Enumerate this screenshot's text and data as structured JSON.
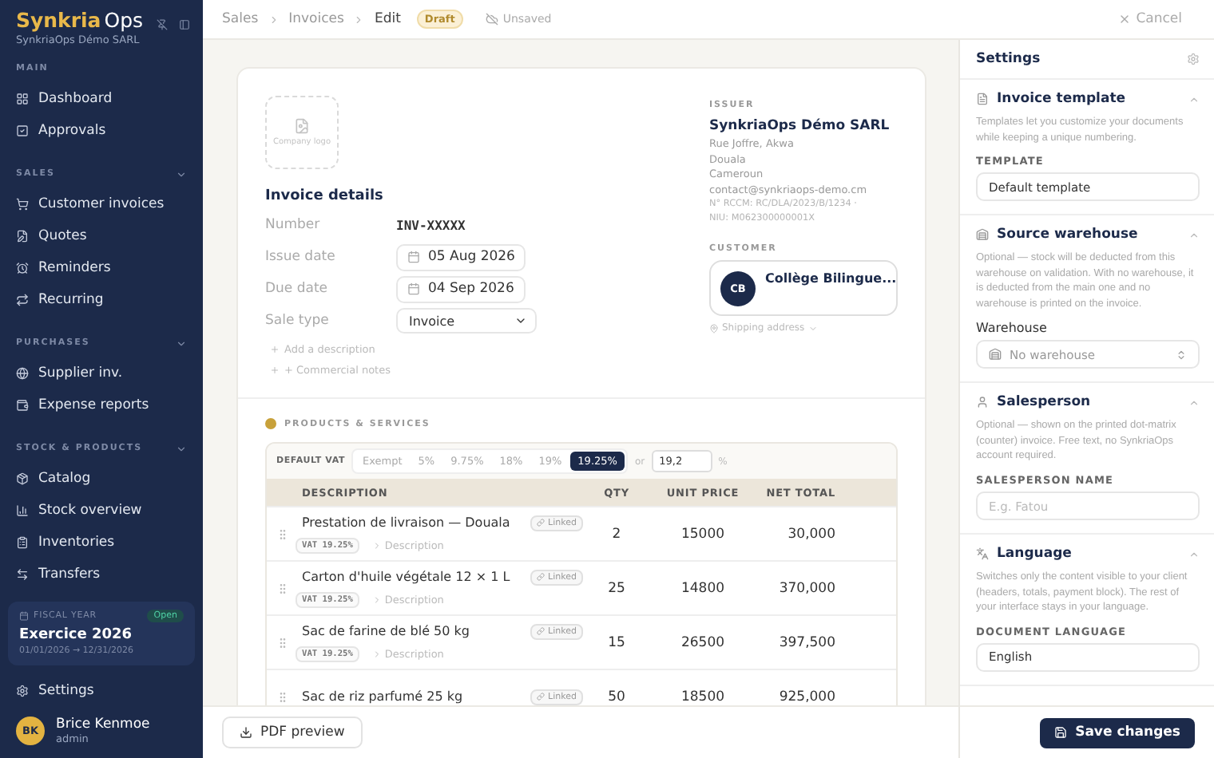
{
  "sidebar": {
    "brand": {
      "primary": "Synkria",
      "secondary": "Ops"
    },
    "company": "SynkriaOps Démo SARL",
    "sections": [
      {
        "label": "MAIN",
        "items": [
          {
            "label": "Dashboard"
          },
          {
            "label": "Approvals"
          }
        ]
      },
      {
        "label": "SALES",
        "expanded": true,
        "items": [
          {
            "label": "Customer invoices"
          },
          {
            "label": "Quotes"
          },
          {
            "label": "Reminders"
          },
          {
            "label": "Recurring"
          }
        ]
      },
      {
        "label": "PURCHASES",
        "expanded": true,
        "items": [
          {
            "label": "Supplier inv."
          },
          {
            "label": "Expense reports"
          }
        ]
      },
      {
        "label": "STOCK & PRODUCTS",
        "expanded": true,
        "items": [
          {
            "label": "Catalog"
          },
          {
            "label": "Stock overview"
          },
          {
            "label": "Inventories"
          },
          {
            "label": "Transfers"
          }
        ]
      }
    ],
    "fiscal_year": {
      "label": "FISCAL YEAR",
      "status": "Open",
      "name": "Exercice 2026",
      "period": "01/01/2026 → 12/31/2026"
    },
    "settings_item": "Settings",
    "user": {
      "initials": "BK",
      "name": "Brice Kenmoe",
      "role": "admin"
    }
  },
  "topbar": {
    "breadcrumbs": [
      "Sales",
      "Invoices",
      "Edit"
    ],
    "badge": "Draft",
    "save_state": "Unsaved",
    "cancel": "Cancel"
  },
  "invoice": {
    "logo_placeholder": "Company logo",
    "details_title": "Invoice details",
    "fields": [
      {
        "kind": "text",
        "label": "Number",
        "value": "INV-XXXXX"
      },
      {
        "kind": "date",
        "label": "Issue date",
        "value": "05 Aug 2026"
      },
      {
        "kind": "date",
        "label": "Due date",
        "value": "04 Sep 2026"
      },
      {
        "kind": "select",
        "label": "Sale type",
        "value": "Invoice"
      }
    ],
    "links": [
      "Add a description",
      "+ Commercial notes"
    ],
    "issuer": {
      "label": "ISSUER",
      "name": "SynkriaOps Démo SARL",
      "address": [
        "Rue Joffre, Akwa",
        "Douala",
        "Cameroun",
        "contact@synkriaops-demo.cm"
      ],
      "legal": [
        "N° RCCM: RC/DLA/2023/B/1234 ·",
        "NIU: M062300000001X"
      ]
    },
    "customer": {
      "label": "CUSTOMER",
      "initials": "CB",
      "name": "Collège Bilingue...",
      "shipping": "Shipping address"
    },
    "products": {
      "title": "PRODUCTS & SERVICES",
      "vat_label": "DEFAULT VAT",
      "vat_options": [
        {
          "label": "Exempt",
          "selected": false
        },
        {
          "label": "5%",
          "selected": false
        },
        {
          "label": "9.75%",
          "selected": false
        },
        {
          "label": "18%",
          "selected": false
        },
        {
          "label": "19%",
          "selected": false
        },
        {
          "label": "19.25%",
          "selected": true
        }
      ],
      "vat_or": "or",
      "vat_custom": "19,2",
      "vat_unit": "%",
      "columns": [
        "DESCRIPTION",
        "QTY",
        "UNIT PRICE",
        "NET TOTAL"
      ],
      "rows": [
        {
          "name": "Prestation de livraison — Douala",
          "linked": "Linked",
          "vat": "VAT 19.25%",
          "description": "Description",
          "qty": "2",
          "unit_price": "15000",
          "net_total": "30,000"
        },
        {
          "name": "Carton d'huile végétale 12 × 1 L",
          "linked": "Linked",
          "vat": "VAT 19.25%",
          "description": "Description",
          "qty": "25",
          "unit_price": "14800",
          "net_total": "370,000"
        },
        {
          "name": "Sac de farine de blé 50 kg",
          "linked": "Linked",
          "vat": "VAT 19.25%",
          "description": "Description",
          "qty": "15",
          "unit_price": "26500",
          "net_total": "397,500"
        },
        {
          "name": "Sac de riz parfumé 25 kg",
          "linked": "Linked",
          "qty": "50",
          "unit_price": "18500",
          "net_total": "925,000"
        }
      ]
    }
  },
  "footer": {
    "preview": "PDF preview"
  },
  "settings_panel": {
    "title": "Settings",
    "save": "Save changes",
    "sections": [
      {
        "title": "Invoice template",
        "expanded": true,
        "description": "Templates let you customize your documents while keeping a unique numbering.",
        "label": {
          "kind": "caps",
          "text": "TEMPLATE"
        },
        "field": {
          "kind": "select",
          "value": "Default template"
        }
      },
      {
        "title": "Source warehouse",
        "expanded": true,
        "description": "Optional — stock will be deducted from this warehouse on validation. With no warehouse, it is deducted from the main one and no warehouse is printed on the invoice.",
        "label": {
          "kind": "plain",
          "text": "Warehouse"
        },
        "field": {
          "kind": "warehouse",
          "placeholder": "No warehouse"
        }
      },
      {
        "title": "Salesperson",
        "expanded": true,
        "description": "Optional — shown on the printed dot-matrix (counter) invoice. Free text, no SynkriaOps account required.",
        "label": {
          "kind": "caps",
          "text": "SALESPERSON NAME"
        },
        "field": {
          "kind": "input",
          "placeholder": "E.g. Fatou"
        }
      },
      {
        "title": "Language",
        "expanded": true,
        "description": "Switches only the content visible to your client (headers, totals, payment block). The rest of your interface stays in your language.",
        "label": {
          "kind": "caps",
          "text": "DOCUMENT LANGUAGE"
        },
        "field": {
          "kind": "select",
          "value": "English"
        }
      }
    ]
  }
}
